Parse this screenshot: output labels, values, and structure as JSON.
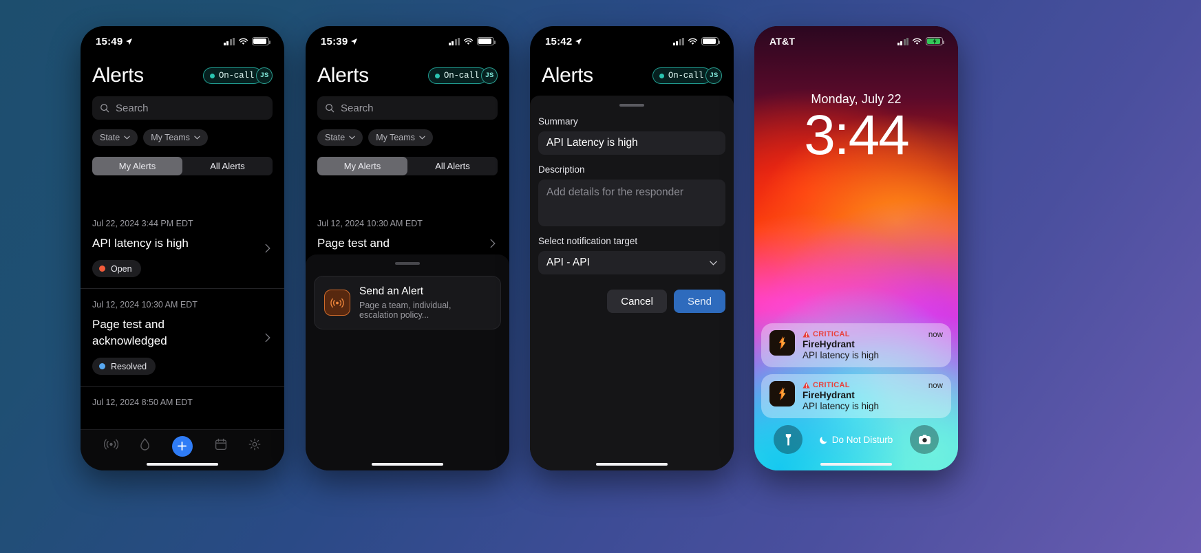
{
  "phone1": {
    "status": {
      "time": "15:49",
      "location_icon": "location-arrow-icon",
      "signal_icon": "cellular-signal-icon",
      "wifi_icon": "wifi-icon",
      "battery_icon": "battery-icon"
    },
    "header": {
      "title": "Alerts",
      "oncall_label": "On-call",
      "avatar_initials": "JS"
    },
    "search": {
      "placeholder": "Search",
      "icon": "search-icon"
    },
    "filters": [
      {
        "label": "State",
        "icon": "chevron-down-icon"
      },
      {
        "label": "My Teams",
        "icon": "chevron-down-icon"
      }
    ],
    "segments": [
      {
        "label": "My Alerts",
        "selected": true
      },
      {
        "label": "All Alerts",
        "selected": false
      }
    ],
    "alerts": [
      {
        "date": "Jul 22, 2024 3:44 PM EDT",
        "title": "API latency is high",
        "status": "Open",
        "status_color": "#f25c3b"
      },
      {
        "date": "Jul 12, 2024 10:30 AM EDT",
        "title": "Page test and acknowledged",
        "status": "Resolved",
        "status_color": "#58a8f0"
      },
      {
        "date": "Jul 12, 2024 8:50 AM EDT",
        "title": "",
        "status": "",
        "status_color": ""
      }
    ],
    "tabs": [
      {
        "name": "alerts-tab",
        "icon": "broadcast-icon"
      },
      {
        "name": "incidents-tab",
        "icon": "fire-drop-icon"
      },
      {
        "name": "create-tab",
        "icon": "plus-icon"
      },
      {
        "name": "schedule-tab",
        "icon": "calendar-icon"
      },
      {
        "name": "settings-tab",
        "icon": "gear-icon"
      }
    ]
  },
  "phone2": {
    "status": {
      "time": "15:39"
    },
    "header": {
      "title": "Alerts",
      "oncall_label": "On-call",
      "avatar_initials": "JS"
    },
    "search": {
      "placeholder": "Search",
      "icon": "search-icon"
    },
    "filters": [
      {
        "label": "State",
        "icon": "chevron-down-icon"
      },
      {
        "label": "My Teams",
        "icon": "chevron-down-icon"
      }
    ],
    "segments": [
      {
        "label": "My Alerts",
        "selected": true
      },
      {
        "label": "All Alerts",
        "selected": false
      }
    ],
    "alerts": [
      {
        "date": "Jul 12, 2024 10:30 AM EDT",
        "title": "Page test and acknowledged"
      }
    ],
    "sheet": {
      "card_title": "Send an Alert",
      "card_subtitle": "Page a team, individual, escalation policy...",
      "card_icon": "broadcast-signal-icon"
    }
  },
  "phone3": {
    "status": {
      "time": "15:42"
    },
    "header": {
      "title": "Alerts",
      "oncall_label": "On-call",
      "avatar_initials": "JS"
    },
    "form": {
      "summary_label": "Summary",
      "summary_value": "API Latency is high",
      "description_label": "Description",
      "description_placeholder": "Add details for the responder",
      "target_label": "Select notification target",
      "target_value": "API - API",
      "target_chevron": "chevron-down-icon",
      "cancel_label": "Cancel",
      "send_label": "Send"
    }
  },
  "phone4": {
    "status": {
      "carrier": "AT&T",
      "battery_state": "charging"
    },
    "lock": {
      "date": "Monday, July 22",
      "time": "3:44",
      "notifications": [
        {
          "level": "CRITICAL",
          "app": "FireHydrant",
          "body": "API latency is high",
          "time": "now",
          "icon": "firehydrant-icon",
          "warning_icon": "warning-triangle-icon"
        },
        {
          "level": "CRITICAL",
          "app": "FireHydrant",
          "body": "API latency is high",
          "time": "now",
          "icon": "firehydrant-icon",
          "warning_icon": "warning-triangle-icon"
        }
      ],
      "flashlight_icon": "flashlight-icon",
      "camera_icon": "camera-icon",
      "dnd_label": "Do Not Disturb",
      "dnd_icon": "moon-icon"
    }
  },
  "colors": {
    "accent_blue": "#2f7cf6",
    "teal": "#2bc4b0",
    "critical_red": "#e8423c",
    "open_orange": "#f25c3b",
    "resolved_blue": "#58a8f0"
  }
}
